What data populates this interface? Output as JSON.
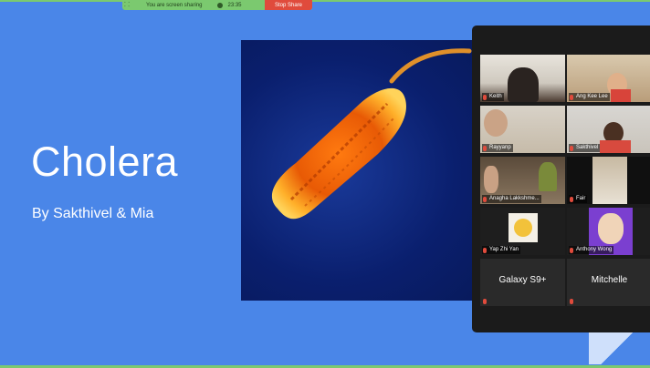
{
  "screen_share": {
    "status_text": "You are screen sharing",
    "timer": "23:35",
    "stop_label": "Stop Share"
  },
  "slide": {
    "title": "Cholera",
    "subtitle": "By Sakthivel & Mia"
  },
  "gallery": {
    "participants": [
      {
        "name": "Keith"
      },
      {
        "name": "Ang Kee Lee"
      },
      {
        "name": "Rayyanp"
      },
      {
        "name": "Sakthivel"
      },
      {
        "name": "Anagha Lakkshme..."
      },
      {
        "name": "Fair"
      },
      {
        "name": "Yap Zhi Yan"
      },
      {
        "name": "Anthony Wong"
      },
      {
        "name": "Galaxy S9+"
      },
      {
        "name": "Mitchelle"
      }
    ]
  },
  "colors": {
    "slide_bg": "#4a86e8",
    "share_green": "#7bc96f",
    "stop_red": "#e04b3c",
    "active_speaker": "#c6e27b",
    "gallery_bg": "#1b1b1b"
  }
}
